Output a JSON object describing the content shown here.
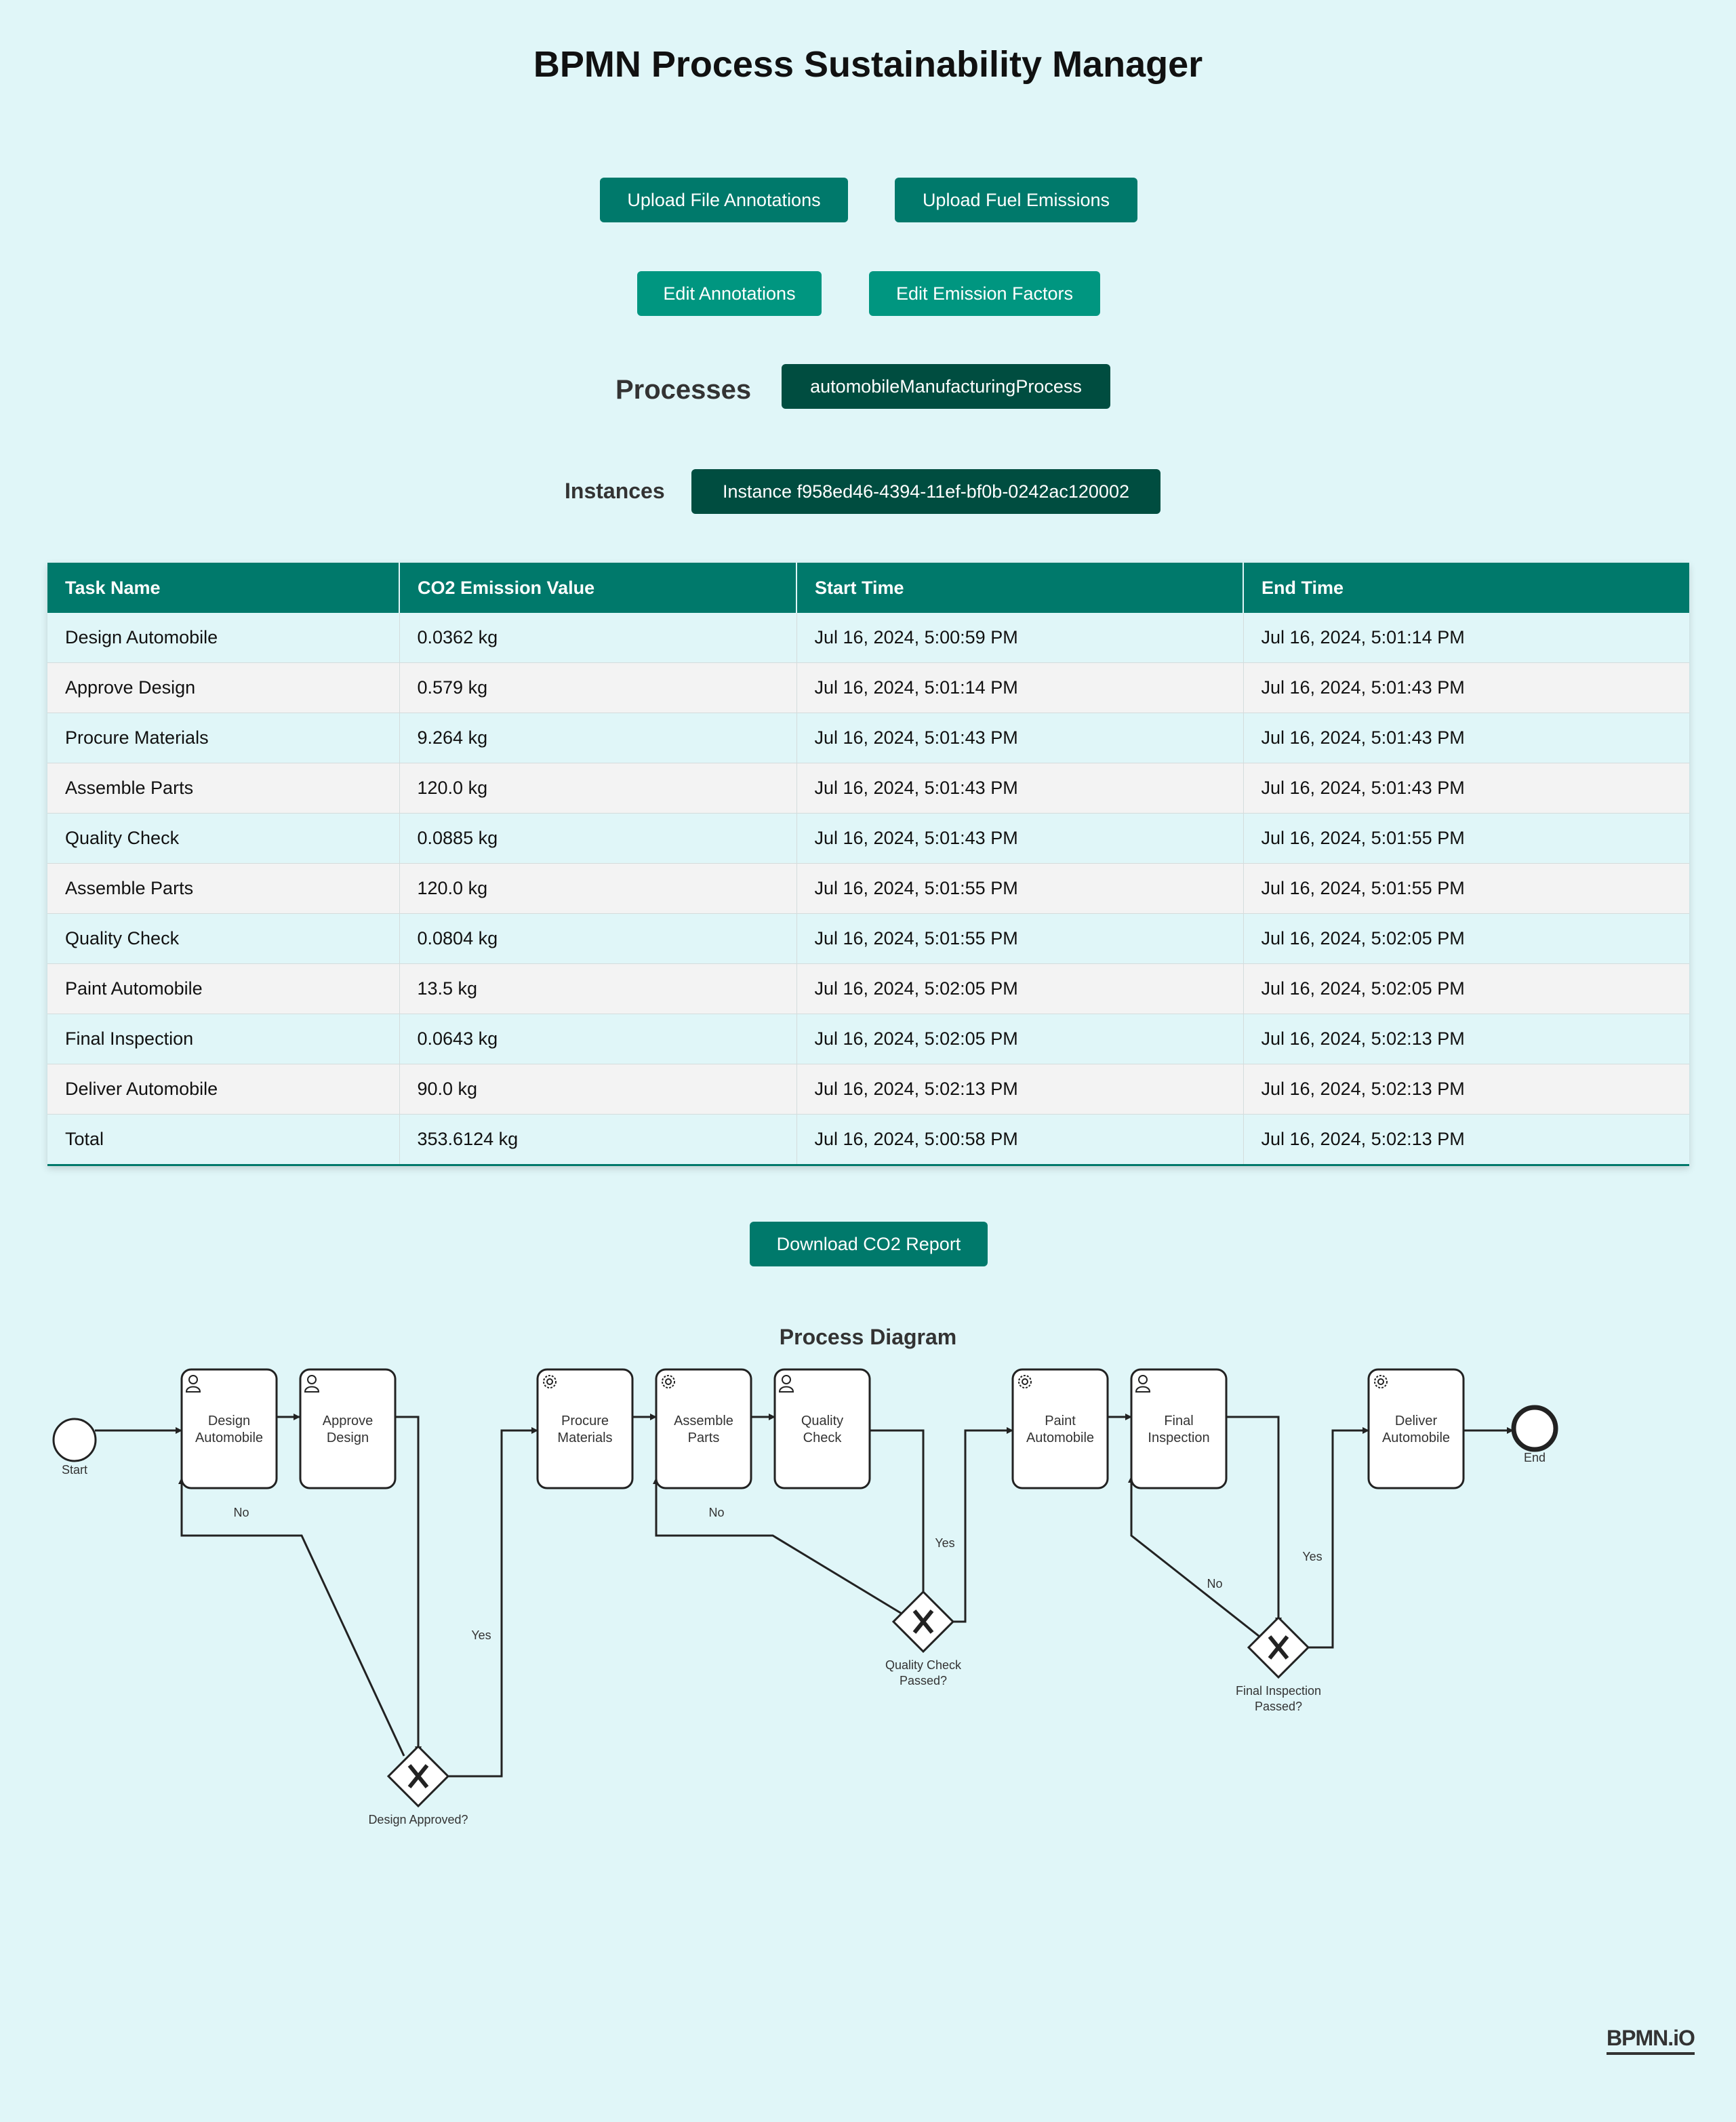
{
  "header": {
    "title": "BPMN Process Sustainability Manager"
  },
  "toolbar": {
    "upload_annotations": "Upload File Annotations",
    "upload_fuel": "Upload Fuel Emissions",
    "edit_annotations": "Edit Annotations",
    "edit_factors": "Edit Emission Factors"
  },
  "processes": {
    "label": "Processes",
    "selected": "automobileManufacturingProcess"
  },
  "instances": {
    "label": "Instances",
    "selected": "Instance f958ed46-4394-11ef-bf0b-0242ac120002"
  },
  "table": {
    "headers": [
      "Task Name",
      "CO2 Emission Value",
      "Start Time",
      "End Time"
    ],
    "rows": [
      [
        "Design Automobile",
        "0.0362 kg",
        "Jul 16, 2024, 5:00:59 PM",
        "Jul 16, 2024, 5:01:14 PM"
      ],
      [
        "Approve Design",
        "0.579 kg",
        "Jul 16, 2024, 5:01:14 PM",
        "Jul 16, 2024, 5:01:43 PM"
      ],
      [
        "Procure Materials",
        "9.264 kg",
        "Jul 16, 2024, 5:01:43 PM",
        "Jul 16, 2024, 5:01:43 PM"
      ],
      [
        "Assemble Parts",
        "120.0 kg",
        "Jul 16, 2024, 5:01:43 PM",
        "Jul 16, 2024, 5:01:43 PM"
      ],
      [
        "Quality Check",
        "0.0885 kg",
        "Jul 16, 2024, 5:01:43 PM",
        "Jul 16, 2024, 5:01:55 PM"
      ],
      [
        "Assemble Parts",
        "120.0 kg",
        "Jul 16, 2024, 5:01:55 PM",
        "Jul 16, 2024, 5:01:55 PM"
      ],
      [
        "Quality Check",
        "0.0804 kg",
        "Jul 16, 2024, 5:01:55 PM",
        "Jul 16, 2024, 5:02:05 PM"
      ],
      [
        "Paint Automobile",
        "13.5 kg",
        "Jul 16, 2024, 5:02:05 PM",
        "Jul 16, 2024, 5:02:05 PM"
      ],
      [
        "Final Inspection",
        "0.0643 kg",
        "Jul 16, 2024, 5:02:05 PM",
        "Jul 16, 2024, 5:02:13 PM"
      ],
      [
        "Deliver Automobile",
        "90.0 kg",
        "Jul 16, 2024, 5:02:13 PM",
        "Jul 16, 2024, 5:02:13 PM"
      ],
      [
        "Total",
        "353.6124 kg",
        "Jul 16, 2024, 5:00:58 PM",
        "Jul 16, 2024, 5:02:13 PM"
      ]
    ]
  },
  "download_label": "Download CO2 Report",
  "diagram": {
    "title": "Process Diagram",
    "start": "Start",
    "end": "End",
    "tasks": {
      "design": [
        "Design",
        "Automobile"
      ],
      "approve": [
        "Approve",
        "Design"
      ],
      "procure": [
        "Procure",
        "Materials"
      ],
      "assemble": [
        "Assemble",
        "Parts"
      ],
      "quality": [
        "Quality",
        "Check"
      ],
      "paint": [
        "Paint",
        "Automobile"
      ],
      "final": [
        "Final",
        "Inspection"
      ],
      "deliver": [
        "Deliver",
        "Automobile"
      ]
    },
    "gateways": {
      "design": [
        "Design Approved?"
      ],
      "quality": [
        "Quality Check",
        "Passed?"
      ],
      "final": [
        "Final Inspection",
        "Passed?"
      ]
    },
    "flow_labels": {
      "yes": "Yes",
      "no": "No"
    }
  },
  "footer": {
    "logo": "BPMN.iO"
  },
  "colors": {
    "accent": "#00796b",
    "accent_mid": "#009680",
    "accent_deep": "#004d40",
    "background": "#e0f6f8"
  }
}
